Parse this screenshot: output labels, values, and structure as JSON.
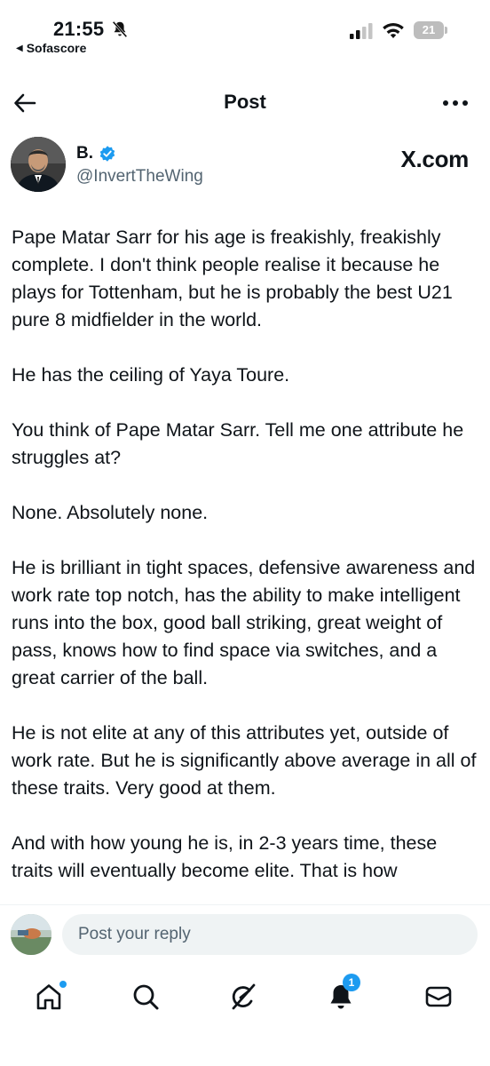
{
  "status_bar": {
    "time": "21:55",
    "back_app": "Sofascore",
    "battery": "21"
  },
  "header": {
    "title": "Post"
  },
  "author": {
    "name": "B.",
    "handle": "@InvertTheWing",
    "source_label": "X.com"
  },
  "tweet": {
    "paragraphs": [
      "Pape Matar Sarr for his age is freakishly, freakishly complete. I don't think people realise it because he plays for Tottenham, but he is probably the best U21 pure 8 midfielder in the world.",
      "He has the ceiling of Yaya Toure.",
      "You think of Pape Matar Sarr. Tell me one attribute he struggles at?",
      "None. Absolutely none.",
      "He is brilliant in tight spaces, defensive awareness and work rate top notch, has the ability to make intelligent runs into the box, good ball striking, great weight of pass, knows how to find space via switches, and a great carrier of the ball.",
      "He is not elite at any of this attributes yet, outside of work rate. But he is significantly above average in all of these traits. Very good at them.",
      "And with how young he is, in 2-3 years time, these traits will eventually become elite. That is how"
    ]
  },
  "reply": {
    "placeholder": "Post your reply"
  },
  "nav": {
    "items": [
      {
        "icon": "home-icon",
        "indicator": "dot"
      },
      {
        "icon": "search-icon"
      },
      {
        "icon": "grok-icon"
      },
      {
        "icon": "notifications-icon",
        "badge": "1"
      },
      {
        "icon": "messages-icon"
      }
    ]
  },
  "colors": {
    "accent": "#1d9bf0",
    "text": "#0f1419",
    "secondary_text": "#536471",
    "input_bg": "#eff3f4"
  }
}
